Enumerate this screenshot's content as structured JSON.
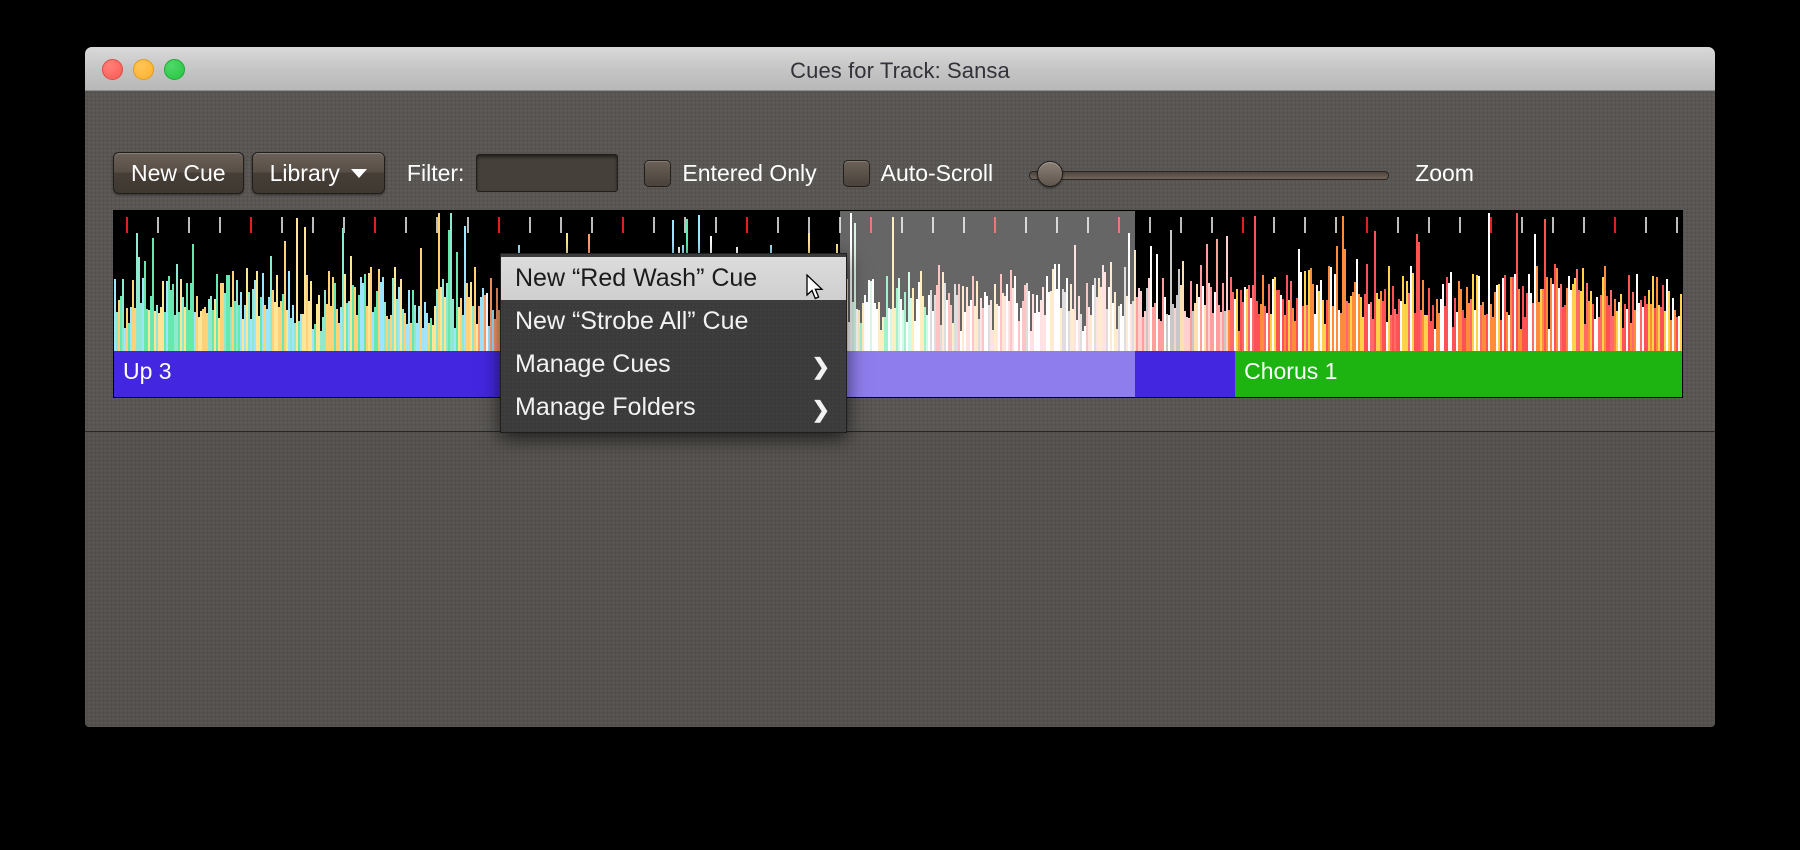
{
  "window": {
    "title": "Cues for Track: Sansa",
    "traffic_lights": [
      "close",
      "minimize",
      "maximize"
    ]
  },
  "toolbar": {
    "new_cue_label": "New Cue",
    "library_label": "Library",
    "library_caret": "chevron-down-icon",
    "filter_label": "Filter:",
    "filter_value": "",
    "filter_placeholder": "",
    "entered_only_label": "Entered Only",
    "entered_only_checked": false,
    "auto_scroll_label": "Auto-Scroll",
    "auto_scroll_checked": false,
    "zoom_label": "Zoom",
    "zoom_slider_value": 4
  },
  "menu": {
    "items": [
      {
        "label": "New “Red Wash” Cue",
        "selected": true,
        "submenu": false
      },
      {
        "label": "New “Strobe All” Cue",
        "selected": false,
        "submenu": false
      },
      {
        "label": "Manage Cues",
        "selected": false,
        "submenu": true,
        "arrow": "chevron-right-icon"
      },
      {
        "label": "Manage Folders",
        "selected": false,
        "submenu": true,
        "arrow": "chevron-right-icon"
      }
    ]
  },
  "timeline": {
    "phrases": [
      {
        "label": "Up 3",
        "color": "#4327e0",
        "start_pct": 0,
        "width_pct": 71.5
      },
      {
        "label": "Chorus 1",
        "color": "#1db310",
        "start_pct": 71.5,
        "width_pct": 28.5
      }
    ],
    "selection": {
      "start_pct": 46.3,
      "width_pct": 18.8
    },
    "waveform_palette": [
      "#66e8b0",
      "#ffe596",
      "#ff9e6e",
      "#ff5252",
      "#9fe5ff",
      "#ffd0d0",
      "#c8c8c8"
    ]
  },
  "colors": {
    "window_bg": "#55524f",
    "titlebar": "#c8c8c8",
    "accent_blue": "#4327e0",
    "accent_green": "#1db310",
    "menu_bg": "#3a3a3a",
    "menu_selected_bg": "#d6d6d6"
  }
}
